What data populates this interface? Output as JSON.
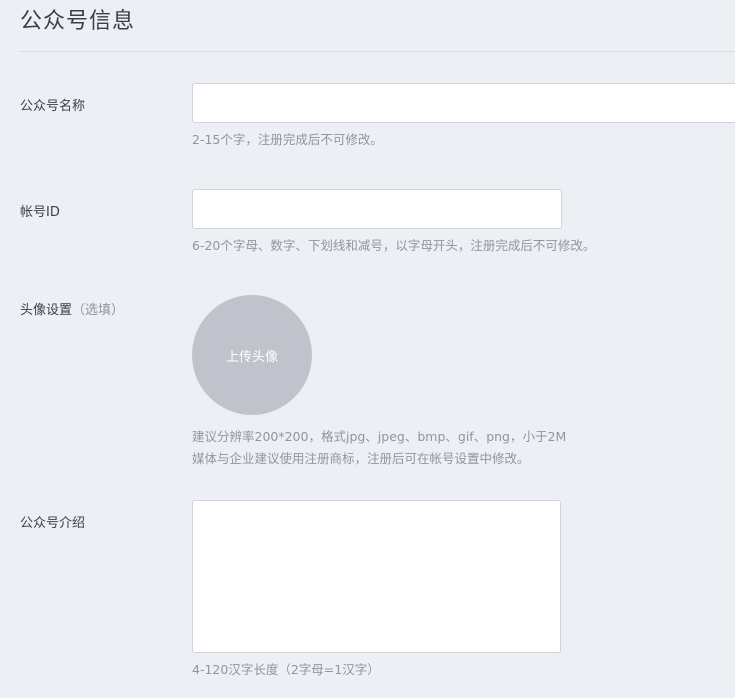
{
  "header": {
    "title": "公众号信息"
  },
  "fields": {
    "name": {
      "label": "公众号名称",
      "value": "",
      "hint": "2-15个字，注册完成后不可修改。"
    },
    "account_id": {
      "label": "帐号ID",
      "value": "",
      "hint": "6-20个字母、数字、下划线和减号，以字母开头，注册完成后不可修改。"
    },
    "avatar": {
      "label": "头像设置",
      "optional": "（选填）",
      "upload_label": "上传头像",
      "hint_line1": "建议分辨率200*200，格式jpg、jpeg、bmp、gif、png，小于2M",
      "hint_line2": "媒体与企业建议使用注册商标，注册后可在帐号设置中修改。"
    },
    "intro": {
      "label": "公众号介绍",
      "value": "",
      "hint": "4-120汉字长度（2字母=1汉字）"
    }
  },
  "colors": {
    "background": "#eceff4",
    "text": "#3a3f4b",
    "hint": "#8f96a3",
    "avatar": "#c1c3cc"
  }
}
